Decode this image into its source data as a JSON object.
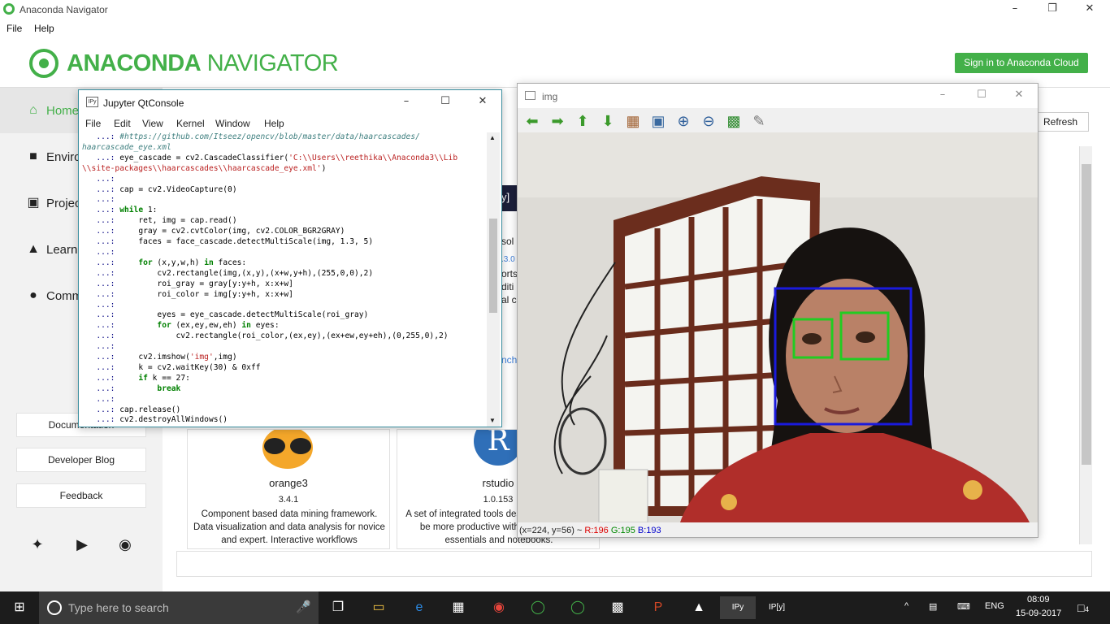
{
  "app": {
    "window_title": "Anaconda Navigator",
    "menu": [
      "File",
      "Help"
    ],
    "brand_strong": "ANACONDA",
    "brand_light": " NAVIGATOR",
    "signin_label": "Sign in to Anaconda Cloud",
    "refresh_label": "Refresh",
    "sidebar": {
      "items": [
        {
          "label": "Home",
          "icon": "home-icon",
          "active": true
        },
        {
          "label": "Environments",
          "icon": "cube-icon",
          "active": false
        },
        {
          "label": "Projects",
          "icon": "briefcase-icon",
          "active": false
        },
        {
          "label": "Learning",
          "icon": "book-icon",
          "active": false
        },
        {
          "label": "Community",
          "icon": "people-icon",
          "active": false
        }
      ],
      "buttons": [
        "Documentation",
        "Developer Blog",
        "Feedback"
      ],
      "social": [
        "twitter-icon",
        "youtube-icon",
        "github-icon"
      ]
    },
    "cards": [
      {
        "name": "orange3",
        "version": "3.4.1",
        "description": "Component based data mining framework. Data visualization and data analysis for novice and expert. Interactive workflows"
      },
      {
        "name": "rstudio",
        "version": "1.0.153",
        "description": "A set of integrated tools designed to help you be more productive with R. Includes R essentials and notebooks."
      }
    ],
    "peek_texts": [
      "sol",
      ".3.0",
      "orts",
      "diti",
      "al c",
      "nch"
    ]
  },
  "qtconsole": {
    "title": "Jupyter QtConsole",
    "menu": [
      "File",
      "Edit",
      "View",
      "Kernel",
      "Window",
      "Help"
    ],
    "code_lines": [
      "   ...: #https://github.com/Itseez/opencv/blob/master/data/haarcascades/",
      "haarcascade_eye.xml",
      "   ...: eye_cascade = cv2.CascadeClassifier('C:\\\\Users\\\\reethika\\\\Anaconda3\\\\Lib",
      "\\\\site-packages\\\\haarcascades\\\\haarcascade_eye.xml')",
      "   ...:",
      "   ...: cap = cv2.VideoCapture(0)",
      "   ...:",
      "   ...: while 1:",
      "   ...:     ret, img = cap.read()",
      "   ...:     gray = cv2.cvtColor(img, cv2.COLOR_BGR2GRAY)",
      "   ...:     faces = face_cascade.detectMultiScale(img, 1.3, 5)",
      "   ...:",
      "   ...:     for (x,y,w,h) in faces:",
      "   ...:         cv2.rectangle(img,(x,y),(x+w,y+h),(255,0,0),2)",
      "   ...:         roi_gray = gray[y:y+h, x:x+w]",
      "   ...:         roi_color = img[y:y+h, x:x+w]",
      "   ...:",
      "   ...:         eyes = eye_cascade.detectMultiScale(roi_gray)",
      "   ...:         for (ex,ey,ew,eh) in eyes:",
      "   ...:             cv2.rectangle(roi_color,(ex,ey),(ex+ew,ey+eh),(0,255,0),2)",
      "   ...:",
      "   ...:     cv2.imshow('img',img)",
      "   ...:     k = cv2.waitKey(30) & 0xff",
      "   ...:     if k == 27:",
      "   ...:         break",
      "   ...:",
      "   ...: cap.release()",
      "   ...: cv2.destroyAllWindows()"
    ]
  },
  "imgwindow": {
    "title": "img",
    "tools": [
      "arrow-left-icon",
      "arrow-right-icon",
      "arrow-up-icon",
      "arrow-down-icon",
      "picture-icon",
      "zoom-fit-icon",
      "zoom-in-icon",
      "zoom-out-icon",
      "save-icon",
      "brush-icon"
    ],
    "status_coords": "(x=224, y=56) ~",
    "status_r": "R:196",
    "status_g": "G:195",
    "status_b": "B:193"
  },
  "taskbar": {
    "search_placeholder": "Type here to search",
    "lang": "ENG",
    "time": "08:09",
    "date": "15-09-2017",
    "notifications": "4"
  },
  "colors": {
    "accent": "#43b049",
    "face_box": "#1a1adc",
    "eye_box": "#22cc22"
  }
}
